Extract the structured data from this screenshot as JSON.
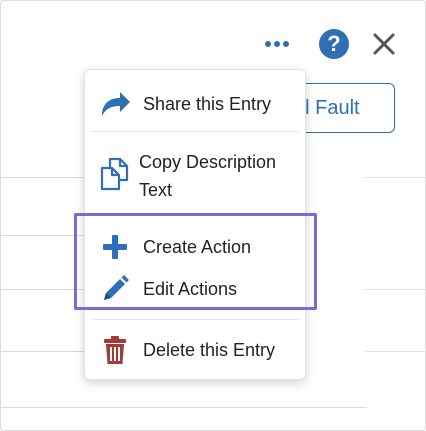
{
  "toolbar": {
    "more_icon": "ellipsis-icon",
    "help_label": "?",
    "close_icon": "close-icon",
    "accent_color": "#2f6fb5"
  },
  "background_button": {
    "label": "al Fault"
  },
  "menu": {
    "items": [
      {
        "label": "Share this Entry",
        "icon": "share-arrow-icon"
      },
      {
        "label": "Copy Description Text",
        "icon": "copy-icon"
      },
      {
        "label": "Create Action",
        "icon": "plus-icon"
      },
      {
        "label": "Edit Actions",
        "icon": "pencil-icon"
      },
      {
        "label": "Delete this Entry",
        "icon": "trash-icon"
      }
    ],
    "highlight_color": "#7a6bd4",
    "delete_icon_color": "#a33a33"
  }
}
